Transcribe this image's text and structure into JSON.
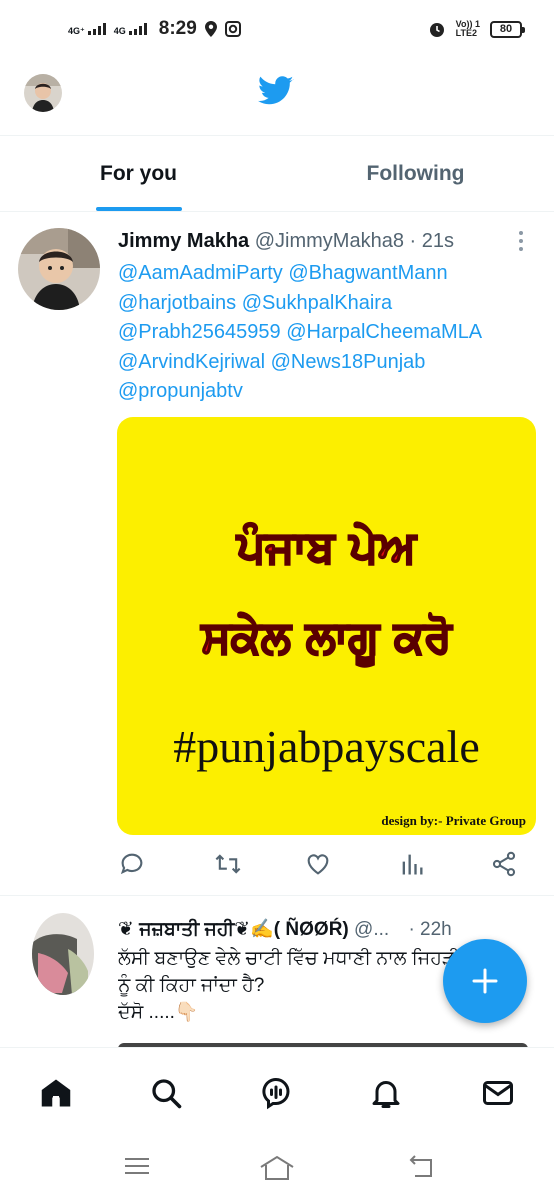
{
  "status_bar": {
    "net1": "4G⁺",
    "net2": "4G",
    "time": "8:29",
    "volte_line1": "Vo)) 1",
    "volte_line2": "LTE2",
    "battery": "80"
  },
  "header": {
    "logo_icon": "twitter-bird-icon",
    "accent_color": "#1d9bf0"
  },
  "tabs": [
    {
      "label": "For you",
      "active": true
    },
    {
      "label": "Following",
      "active": false
    }
  ],
  "tweet1": {
    "name": "Jimmy Makha",
    "handle": "@JimmyMakha8",
    "time": "· 21s",
    "body_lines": [
      "@AamAadmiParty @BhagwantMann",
      "@harjotbains @SukhpalKhaira",
      "@Prabh25645959 @HarpalCheemaMLA",
      "@ArvindKejriwal @News18Punjab",
      "@propunjabtv"
    ],
    "image": {
      "line1": "ਪੰਜਾਬ ਪੇਅ",
      "line2": "ਸਕੇਲ ਲਾਗੂ ਕਰੋ",
      "hashtag": "#punjabpayscale",
      "credit": "design by:- Private Group",
      "background": "#fcef00"
    },
    "actions": [
      "reply-icon",
      "retweet-icon",
      "like-icon",
      "views-icon",
      "share-icon"
    ]
  },
  "tweet2": {
    "name": "❦ ਜਜ਼ਬਾਤੀ ਜਹੀ❦✍️( ÑØØŔ)",
    "handle": "@...",
    "time": "· 22h",
    "body_lines": [
      "ਲੱਸੀ ਬਣਾਉਣ ਵੇਲੇ ਚਾਟੀ ਵਿੱਚ ਮਧਾਣੀ ਨਾਲ ਜਿਹੜੀ",
      "ਨੂੰ ਕੀ ਕਿਹਾ ਜਾਂਦਾ ਹੈ?",
      "ਦੱਸੋ .....👇🏻"
    ]
  },
  "fab": {
    "icon": "compose-plus-icon"
  },
  "bottom_nav": [
    "home-icon",
    "search-icon",
    "spaces-icon",
    "notifications-icon",
    "messages-icon"
  ],
  "system_nav": [
    "menu-icon",
    "home-icon",
    "back-icon"
  ]
}
